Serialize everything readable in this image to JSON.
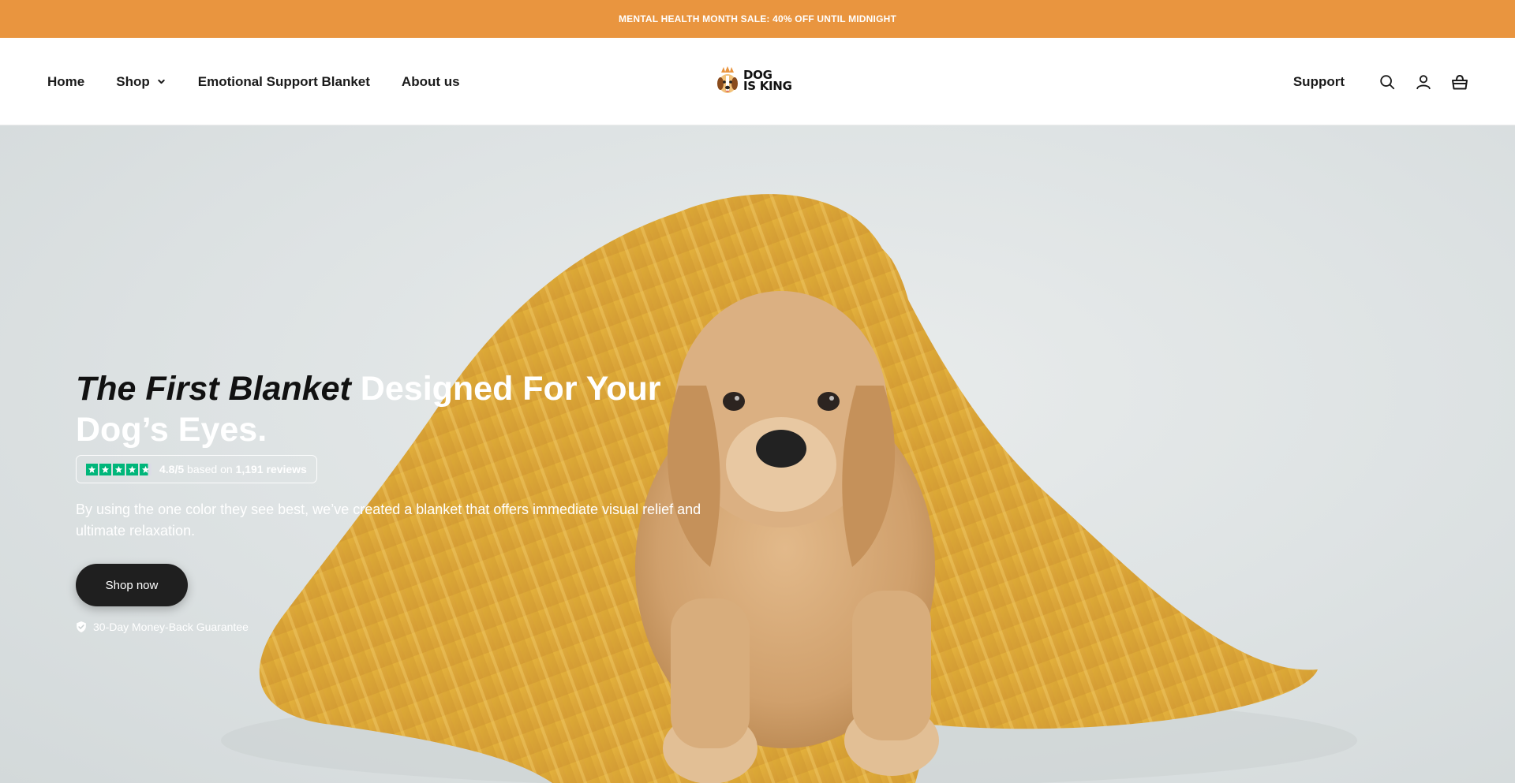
{
  "announcement": {
    "text": "MENTAL HEALTH MONTH SALE: 40% OFF UNTIL MIDNIGHT"
  },
  "nav": {
    "left": [
      {
        "label": "Home"
      },
      {
        "label": "Shop",
        "icon": "chevron-down-icon"
      },
      {
        "label": "Emotional Support Blanket"
      },
      {
        "label": "About us"
      }
    ],
    "support_label": "Support",
    "icons": [
      "search-icon",
      "account-icon",
      "cart-icon"
    ]
  },
  "logo": {
    "line1": "DOG",
    "line2": "IS KING"
  },
  "hero": {
    "title_italic": "The First Blanket",
    "title_rest": " Designed For Your Dog’s Eyes.",
    "rating": {
      "score": "4.8/5",
      "middle": " based on ",
      "reviews": "1,191 reviews",
      "stars": 4.8
    },
    "description": "By using the one color they see best, we’ve created a blanket that offers immediate visual relief and ultimate relaxation.",
    "cta_label": "Shop now",
    "guarantee": "30-Day Money-Back Guarantee"
  },
  "colors": {
    "announcement_bg": "#E9953F",
    "trustpilot_green": "#00B67A",
    "cta_bg": "#1f1f1f"
  }
}
